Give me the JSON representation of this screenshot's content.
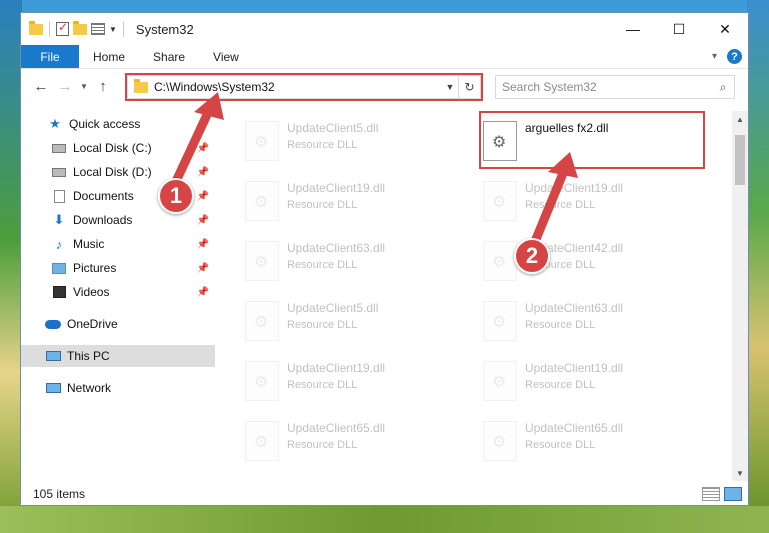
{
  "window": {
    "title": "System32"
  },
  "ribbon": {
    "tabs": [
      "File",
      "Home",
      "Share",
      "View"
    ]
  },
  "window_controls": {
    "minimize": "—",
    "maximize": "☐",
    "close": "✕"
  },
  "address": {
    "path": "C:\\Windows\\System32"
  },
  "search": {
    "placeholder": "Search System32"
  },
  "sidebar": {
    "items": [
      {
        "label": "Quick access",
        "icon": "star-icon"
      },
      {
        "label": "Local Disk (C:)",
        "icon": "drive-icon",
        "pinned": true
      },
      {
        "label": "Local Disk (D:)",
        "icon": "drive-icon",
        "pinned": true
      },
      {
        "label": "Documents",
        "icon": "documents-icon",
        "pinned": true
      },
      {
        "label": "Downloads",
        "icon": "downloads-icon",
        "pinned": true
      },
      {
        "label": "Music",
        "icon": "music-icon",
        "pinned": true
      },
      {
        "label": "Pictures",
        "icon": "pictures-icon",
        "pinned": true
      },
      {
        "label": "Videos",
        "icon": "videos-icon",
        "pinned": true
      },
      {
        "label": "OneDrive",
        "icon": "onedrive-icon"
      },
      {
        "label": "This PC",
        "icon": "this-pc-icon",
        "selected": true
      },
      {
        "label": "Network",
        "icon": "network-icon"
      }
    ]
  },
  "files": {
    "col1": [
      {
        "name": "UpdateClient5.dll",
        "type": "Resource DLL"
      },
      {
        "name": "UpdateClient19.dll",
        "type": "Resource DLL"
      },
      {
        "name": "UpdateClient63.dll",
        "type": "Resource DLL"
      },
      {
        "name": "UpdateClient5.dll",
        "type": "Resource DLL"
      },
      {
        "name": "UpdateClient19.dll",
        "type": "Resource DLL"
      },
      {
        "name": "UpdateClient65.dll",
        "type": "Resource DLL"
      }
    ],
    "col2": [
      {
        "name": "arguelles fx2.dll",
        "type": ""
      },
      {
        "name": "UpdateClient19.dll",
        "type": "Resource DLL"
      },
      {
        "name": "UpdateClient42.dll",
        "type": "Resource DLL"
      },
      {
        "name": "UpdateClient63.dll",
        "type": "Resource DLL"
      },
      {
        "name": "UpdateClient19.dll",
        "type": "Resource DLL"
      },
      {
        "name": "UpdateClient65.dll",
        "type": "Resource DLL"
      }
    ]
  },
  "status": {
    "count": "105 items"
  },
  "annotations": {
    "step1": "1",
    "step2": "2"
  },
  "colors": {
    "accent": "#1979ca",
    "highlight": "#d64545"
  }
}
